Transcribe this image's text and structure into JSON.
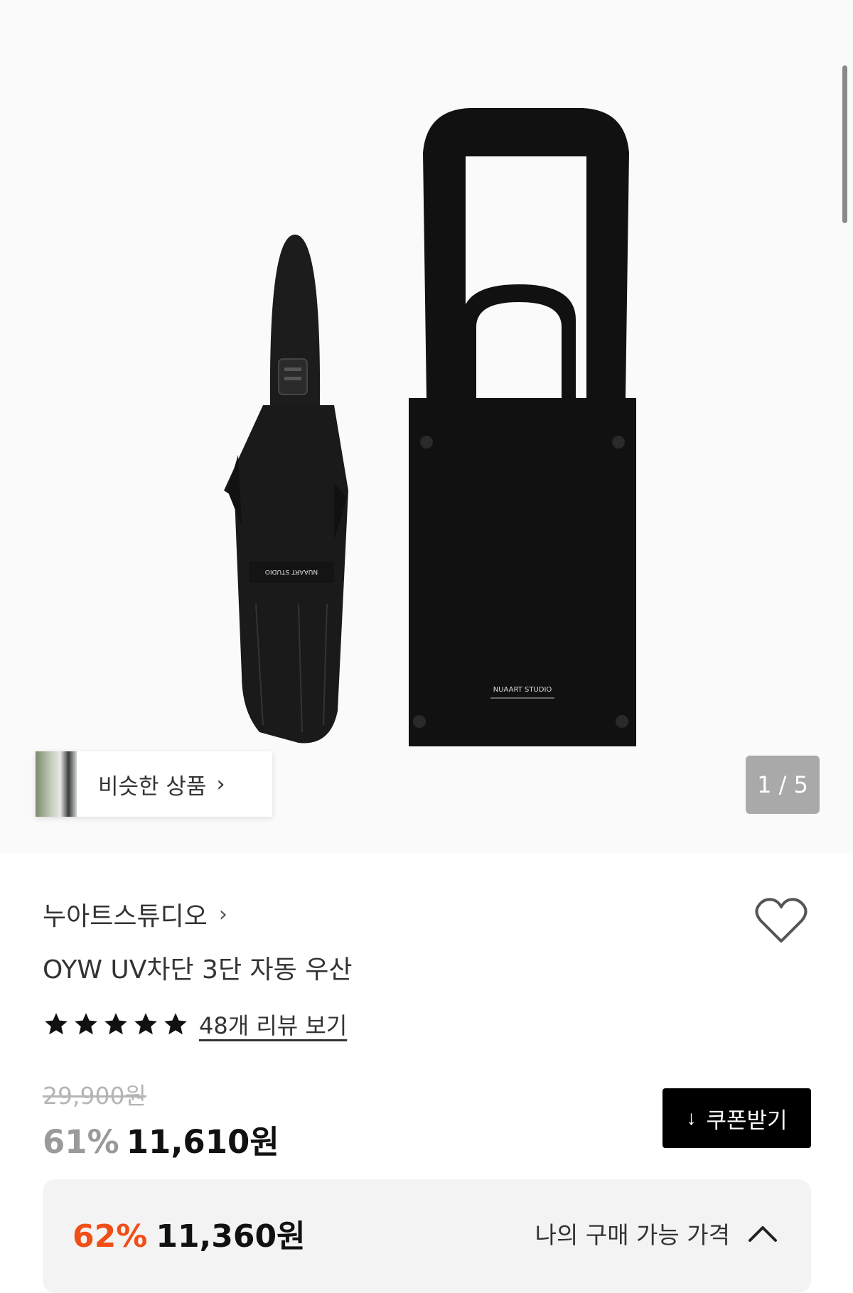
{
  "gallery": {
    "similar_label": "비슷한 상품",
    "similar_chevron": "›",
    "counter": "1 / 5"
  },
  "product": {
    "brand": "누아트스튜디오",
    "brand_chevron": "›",
    "title": "OYW UV차단 3단 자동 우산",
    "rating_stars": 5,
    "review_link": "48개 리뷰 보기",
    "original_price": "29,900원",
    "discount": "61%",
    "price": "11,610원",
    "coupon_icon": "↓",
    "coupon_label": "쿠폰받기"
  },
  "my_price": {
    "discount": "62%",
    "price": "11,360원",
    "label": "나의 구매 가능 가격"
  },
  "colors": {
    "accent": "#f04e17",
    "button_bg": "#000000",
    "counter_bg": "#a9a9a9"
  }
}
